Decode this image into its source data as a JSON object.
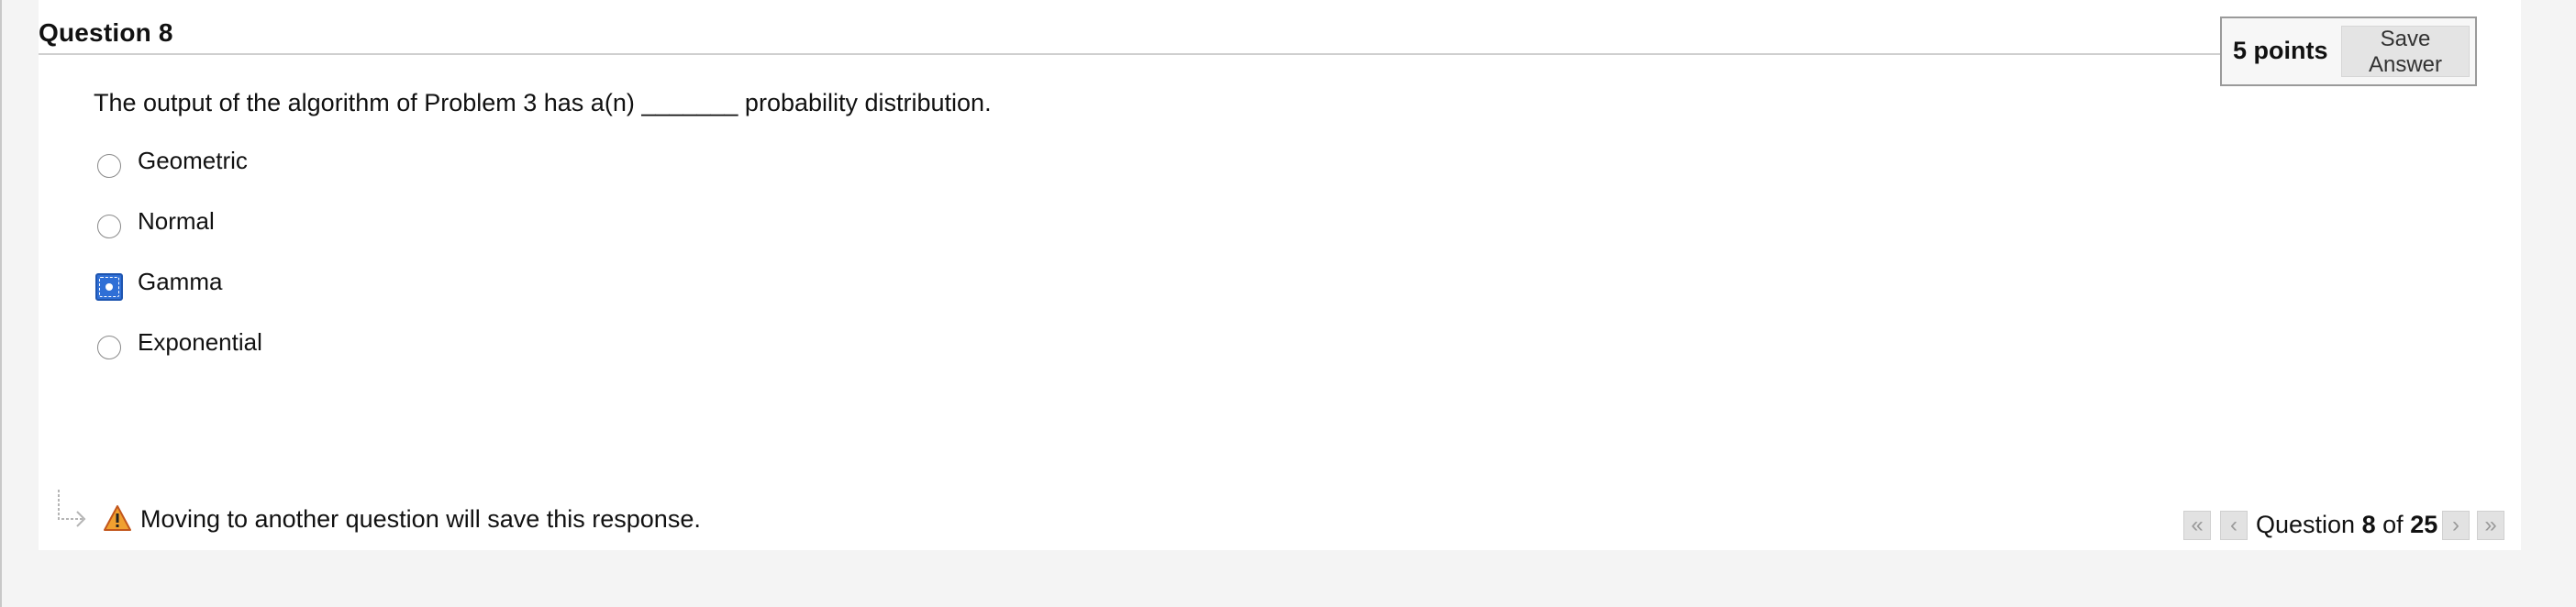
{
  "question": {
    "title": "Question 8",
    "points": "5 points",
    "save_label": "Save Answer",
    "text": "The output of the algorithm of Problem 3 has a(n) _______ probability distribution.",
    "options": [
      {
        "label": "Geometric",
        "selected": false
      },
      {
        "label": "Normal",
        "selected": false
      },
      {
        "label": "Gamma",
        "selected": true
      },
      {
        "label": "Exponential",
        "selected": false
      }
    ]
  },
  "footer": {
    "warning": "Moving to another question will save this response.",
    "nav": {
      "prefix": "Question",
      "current": "8",
      "of": "of",
      "total": "25",
      "first_icon": "double-chevron-left-icon",
      "prev_icon": "chevron-left-icon",
      "next_icon": "chevron-right-icon",
      "last_icon": "double-chevron-right-icon"
    }
  },
  "colors": {
    "selected_radio": "#2f6fd6",
    "warning_icon": "#f0a030"
  }
}
